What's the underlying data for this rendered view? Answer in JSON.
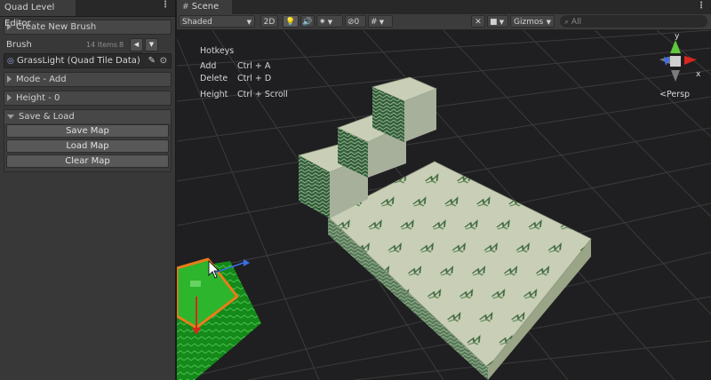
{
  "panel": {
    "title": "Quad Level Editor",
    "create_brush": "Create New Brush",
    "brush_label": "Brush",
    "brush_count": "14 Items",
    "brush_index": "8",
    "brush_value": "GrassLight (Quad Tile Data)",
    "mode": "Mode - Add",
    "height": "Height - 0",
    "save_load": "Save & Load",
    "save_map": "Save Map",
    "load_map": "Load Map",
    "clear_map": "Clear Map"
  },
  "scene": {
    "tab": "Scene",
    "shading": "Shaded",
    "mode_2d": "2D",
    "hidden_count": "0",
    "gizmos": "Gizmos",
    "search_placeholder": "All",
    "persp": "Persp",
    "axis_y": "y",
    "axis_x": "x"
  },
  "hotkeys": {
    "title": "Hotkeys",
    "rows": [
      {
        "action": "Add",
        "keys": "Ctrl + A"
      },
      {
        "action": "Delete",
        "keys": "Ctrl + D"
      },
      {
        "action": "Height",
        "keys": "Ctrl + Scroll"
      }
    ]
  },
  "icons": [
    "kebab-menu-icon",
    "scene-grid-icon",
    "lightbulb-icon",
    "audio-icon",
    "effects-icon",
    "visibility-icon",
    "grid-toggle-icon",
    "tools-icon",
    "camera-icon",
    "dropdown-arrow-icon",
    "scene-gizmo-icon",
    "cursor-arrow-icon",
    "move-handle-icon",
    "object-picker-icon",
    "pencil-icon"
  ],
  "colors": {
    "panel_bg": "#383838",
    "scene_bg": "#1f1f21",
    "tile_light": "#c9cfb6",
    "tile_dark": "#2f5d33",
    "selection": "#e87d19",
    "selected_fill": "#2db52d"
  }
}
